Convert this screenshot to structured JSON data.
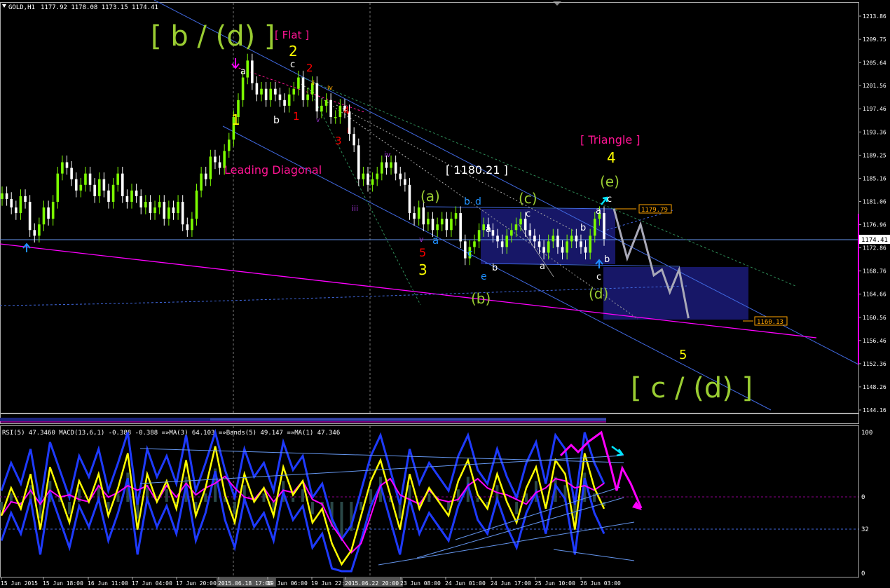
{
  "header": {
    "symbol_timeframe": "GOLD,H1",
    "ohlc": "1177.92 1178.08 1173.15 1174.41"
  },
  "indicator_header": "RSI(5) 47.3460  MACD(13,6,1) -0.388 -0.388  =»MA(3) 64.103  =»Bands(5) 49.147  =»MA(1) 47.346",
  "colors": {
    "background": "#000000",
    "candle_up": "#7CFC00",
    "candle_down": "#FFFFFF",
    "label_green": "#9ACD32",
    "label_yellow": "#FFFF00",
    "label_red": "#FF0000",
    "label_magenta": "#FF1493",
    "label_blue": "#1E90FF",
    "trend_line": "#4169E1",
    "box_fill": "#191970",
    "rsi_line": "#FFFF00",
    "ma_line": "#FF00FF",
    "bands_line": "#4169E1",
    "forecast": "#A9A9B8"
  },
  "chart_data": {
    "type": "candlestick",
    "symbol": "GOLD",
    "timeframe": "H1",
    "y_axis_ticks": [
      "1213.86",
      "1209.75",
      "1205.64",
      "1201.56",
      "1197.46",
      "1193.36",
      "1189.25",
      "1185.16",
      "1181.06",
      "1176.96",
      "1172.86",
      "1168.76",
      "1164.66",
      "1160.56",
      "1156.46",
      "1152.36",
      "1148.26",
      "1144.16"
    ],
    "ylim": [
      1142,
      1215
    ],
    "x_axis_labels": [
      "15 Jun 2015",
      "15 Jun 18:00",
      "16 Jun 11:00",
      "17 Jun 04:00",
      "17 Jun 20:00",
      "2015.06.18 17:00",
      "19 Jun 06:00",
      "19 Jun 22:00",
      "2015.06.22 20:00",
      "23 Jun 08:00",
      "24 Jun 01:00",
      "24 Jun 17:00",
      "25 Jun 10:00",
      "26 Jun 03:00"
    ],
    "current_price": "1174.41",
    "level_labels": [
      {
        "text": "1179.79",
        "value": 1179.79
      },
      {
        "text": "1160.13",
        "value": 1160.13
      }
    ],
    "approx_close_path": [
      1182.5,
      1181.5,
      1180,
      1179,
      1182,
      1181,
      1176,
      1175,
      1177,
      1180,
      1178,
      1181,
      1186,
      1188,
      1187,
      1185,
      1183,
      1184,
      1186,
      1184,
      1182,
      1185,
      1183,
      1181,
      1184,
      1186,
      1182,
      1181,
      1183,
      1182,
      1180,
      1181,
      1179,
      1180,
      1181,
      1178,
      1180,
      1179,
      1181,
      1177,
      1176,
      1178,
      1183,
      1186,
      1185,
      1189,
      1188,
      1187,
      1190,
      1192,
      1196,
      1199,
      1203,
      1206,
      1202,
      1200,
      1201,
      1199,
      1201,
      1200,
      1199,
      1198,
      1200,
      1201,
      1203,
      1199,
      1200,
      1202,
      1197,
      1198,
      1199,
      1196,
      1196,
      1198,
      1197,
      1193,
      1191,
      1185,
      1186,
      1184,
      1185,
      1186,
      1188,
      1187,
      1188,
      1186,
      1185,
      1184,
      1179,
      1178,
      1180,
      1177,
      1178,
      1176,
      1177,
      1178,
      1176,
      1178,
      1179,
      1174,
      1171,
      1173,
      1174,
      1176,
      1177,
      1176,
      1175,
      1174,
      1173,
      1175,
      1176,
      1177,
      1178,
      1176,
      1175,
      1174,
      1173,
      1172,
      1174,
      1175,
      1173,
      1172,
      1174,
      1175,
      1174,
      1173,
      1172,
      1175,
      1178,
      1179,
      1174.41
    ],
    "forecast_path": [
      [
        1179.8,
        0
      ],
      [
        1171,
        1
      ],
      [
        1177,
        2
      ],
      [
        1168,
        3
      ],
      [
        1169,
        3.6
      ],
      [
        1165,
        4.2
      ],
      [
        1169,
        4.9
      ],
      [
        1160.4,
        5.6
      ]
    ],
    "rsi_panel": {
      "ticks": [
        "100",
        "0",
        "32",
        "0"
      ],
      "approx_rsi": [
        40,
        60,
        45,
        70,
        30,
        75,
        55,
        35,
        65,
        50,
        70,
        40,
        60,
        85,
        30,
        70,
        50,
        65,
        45,
        80,
        40,
        60,
        90,
        55,
        35,
        70,
        50,
        60,
        40,
        75,
        55,
        65,
        35,
        45,
        20,
        5,
        15,
        40,
        65,
        80,
        55,
        30,
        70,
        45,
        60,
        50,
        40,
        65,
        80,
        55,
        45,
        70,
        50,
        35,
        60,
        75,
        45,
        80,
        70,
        30,
        85,
        60,
        45
      ]
    },
    "wave_labels": [
      {
        "text": "[ b / (d) ]",
        "color": "label_green"
      },
      {
        "text": "[ Flat ]",
        "color": "label_magenta"
      },
      {
        "text": "2",
        "color": "label_yellow"
      },
      {
        "text": "a",
        "color": "candle_down"
      },
      {
        "text": "c",
        "color": "candle_down"
      },
      {
        "text": "2",
        "color": "label_red"
      },
      {
        "text": "1",
        "color": "label_yellow"
      },
      {
        "text": "b",
        "color": "candle_down"
      },
      {
        "text": "1",
        "color": "label_red"
      },
      {
        "text": "ii",
        "color": "label_orange"
      },
      {
        "text": "iv",
        "color": "label_orange"
      },
      {
        "text": "4",
        "color": "label_red"
      },
      {
        "text": "3",
        "color": "label_red"
      },
      {
        "text": "v",
        "color": "label_violet"
      },
      {
        "text": "i",
        "color": "label_red"
      },
      {
        "text": "iv",
        "color": "label_violet"
      },
      {
        "text": "iii",
        "color": "label_violet"
      },
      {
        "text": "Leading Diagonal",
        "color": "label_magenta"
      },
      {
        "text": "[ 1180.21 ]",
        "color": "candle_down"
      },
      {
        "text": "(a)",
        "color": "label_green"
      },
      {
        "text": "b",
        "color": "label_blue"
      },
      {
        "text": "d",
        "color": "label_blue"
      },
      {
        "text": "(c)",
        "color": "label_green"
      },
      {
        "text": "c",
        "color": "candle_down"
      },
      {
        "text": "[ Triangle ]",
        "color": "label_magenta"
      },
      {
        "text": "4",
        "color": "label_yellow"
      },
      {
        "text": "(e)",
        "color": "label_green"
      },
      {
        "text": "c",
        "color": "candle_down"
      },
      {
        "text": "a",
        "color": "candle_down"
      },
      {
        "text": "a",
        "color": "candle_down"
      },
      {
        "text": "b",
        "color": "candle_down"
      },
      {
        "text": "v",
        "color": "label_violet"
      },
      {
        "text": "5",
        "color": "label_red"
      },
      {
        "text": "a",
        "color": "label_blue"
      },
      {
        "text": "c",
        "color": "label_blue"
      },
      {
        "text": "3",
        "color": "label_yellow"
      },
      {
        "text": "b",
        "color": "candle_down"
      },
      {
        "text": "a",
        "color": "candle_down"
      },
      {
        "text": "e",
        "color": "label_blue"
      },
      {
        "text": "b",
        "color": "candle_down"
      },
      {
        "text": "c",
        "color": "candle_down"
      },
      {
        "text": "(b)",
        "color": "label_green"
      },
      {
        "text": "(d)",
        "color": "label_green"
      },
      {
        "text": "5",
        "color": "label_yellow"
      },
      {
        "text": "[ c / (d) ]",
        "color": "label_green"
      }
    ]
  }
}
